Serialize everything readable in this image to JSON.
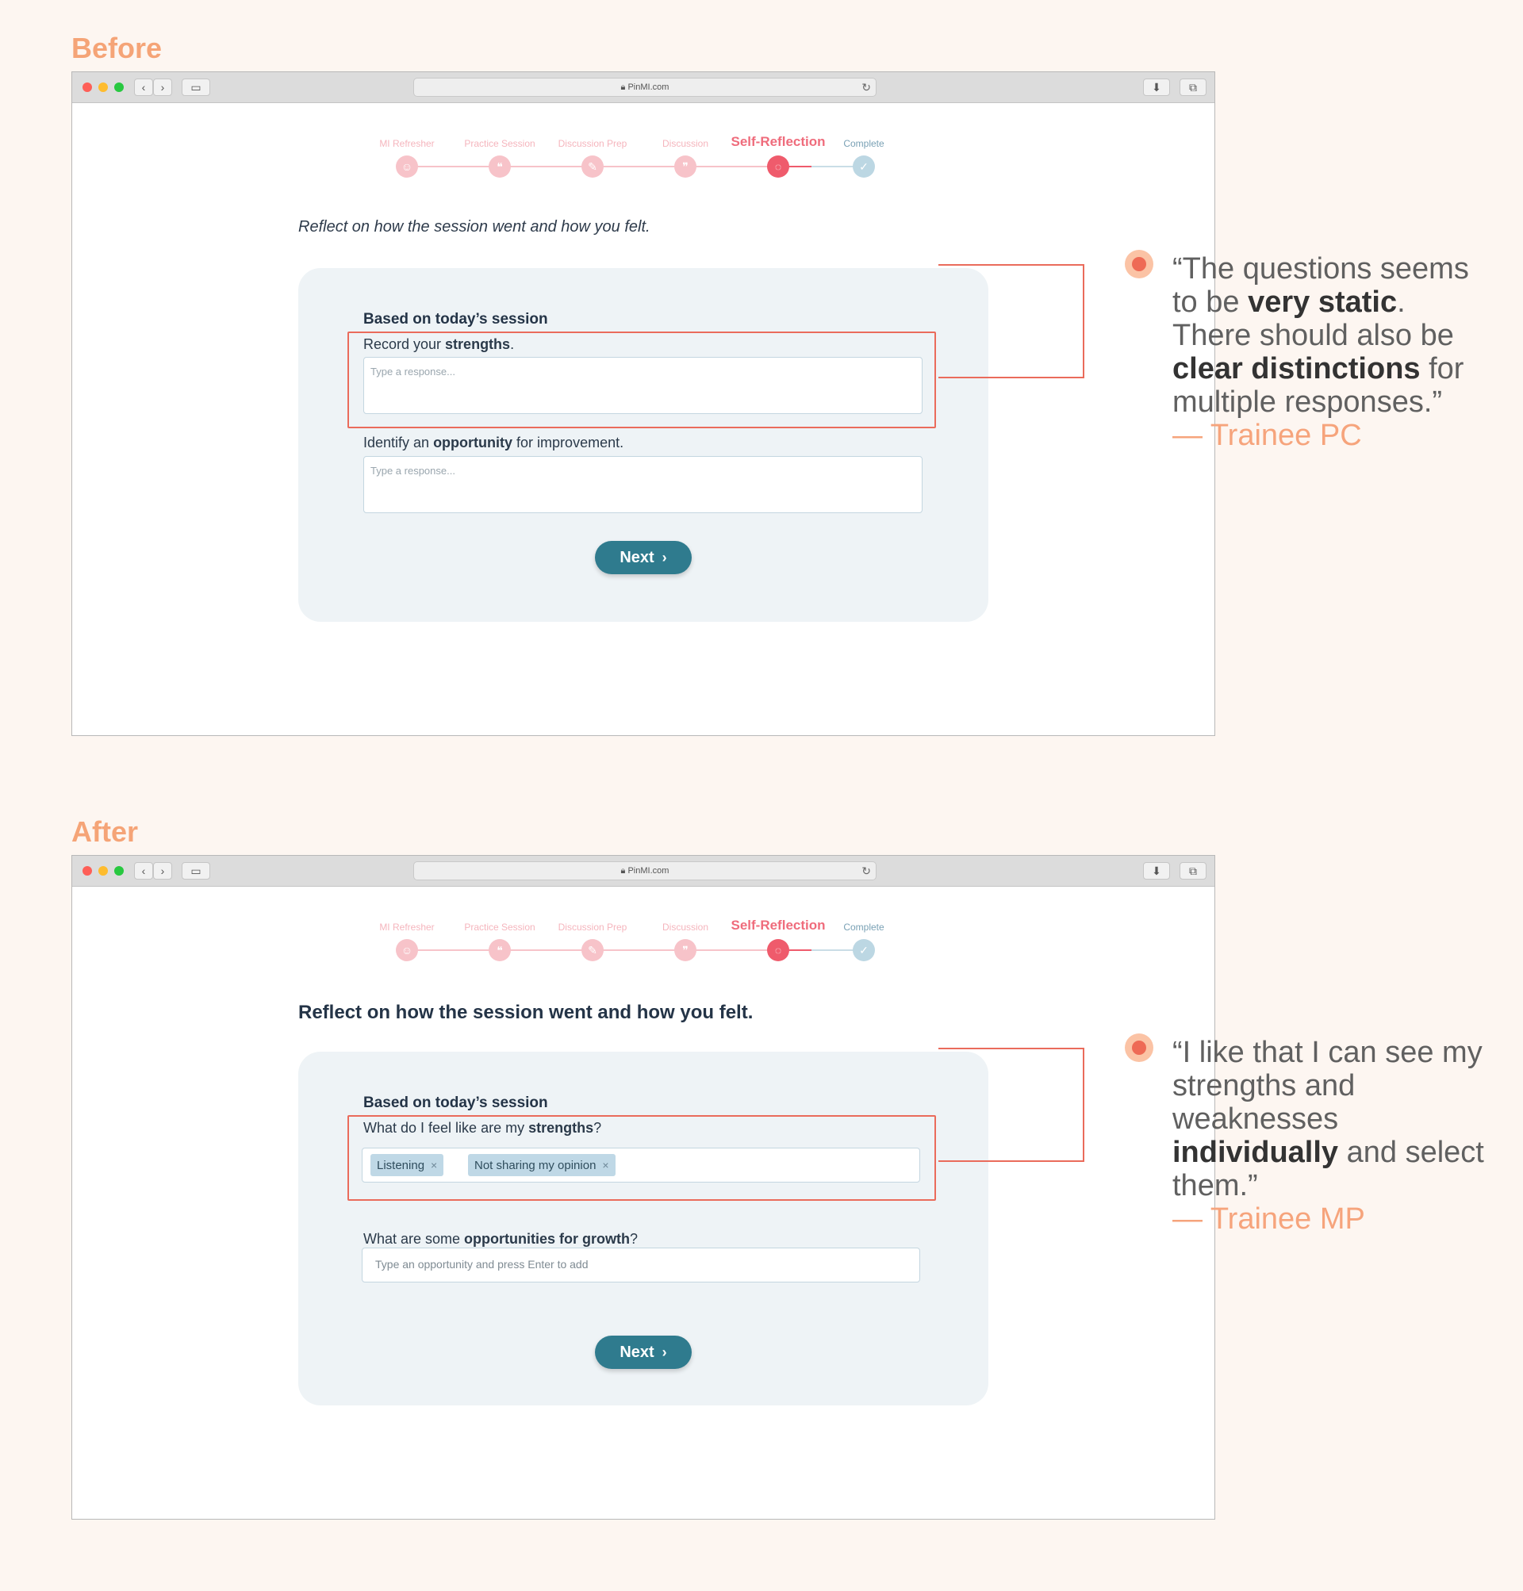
{
  "before": {
    "section_label": "Before",
    "url": "PinMI.com",
    "steps": [
      {
        "label": "MI Refresher"
      },
      {
        "label": "Practice Session"
      },
      {
        "label": "Discussion Prep"
      },
      {
        "label": "Discussion"
      },
      {
        "label": "Self-Reflection"
      },
      {
        "label": "Complete"
      }
    ],
    "prompt": "Reflect on how the session went and how you felt.",
    "card_title": "Based on today’s session",
    "q1_prefix": "Record your ",
    "q1_bold": "strengths",
    "q1_suffix": ".",
    "q1_placeholder": "Type a response...",
    "q2_prefix": "Identify an ",
    "q2_bold": "opportunity",
    "q2_suffix": " for improvement.",
    "q2_placeholder": "Type a response...",
    "next_label": "Next",
    "quote": {
      "p1": "“The questions seems to be ",
      "b1": "very static",
      "p2": ". There should also be ",
      "b2": "clear distinctions",
      "p3": " for multiple responses.”",
      "author": "— Trainee PC"
    }
  },
  "after": {
    "section_label": "After",
    "url": "PinMI.com",
    "steps": [
      {
        "label": "MI Refresher"
      },
      {
        "label": "Practice Session"
      },
      {
        "label": "Discussion Prep"
      },
      {
        "label": "Discussion"
      },
      {
        "label": "Self-Reflection"
      },
      {
        "label": "Complete"
      }
    ],
    "prompt": "Reflect on how the session went and how you felt.",
    "card_title": "Based on today’s session",
    "q1_prefix": "What do I feel like are my ",
    "q1_bold": "strengths",
    "q1_suffix": "?",
    "chips": [
      "Listening",
      "Not sharing my opinion"
    ],
    "q2_prefix": "What are some ",
    "q2_bold": "opportunities for growth",
    "q2_suffix": "?",
    "q2_placeholder": "Type an opportunity and press Enter to add",
    "next_label": "Next",
    "quote": {
      "p1": "“I like that I can see my strengths and weaknesses ",
      "b1": "individually",
      "p2": " and select them.”",
      "author": "— Trainee MP"
    }
  },
  "colors": {
    "accent": "#f5a477",
    "highlight": "#ea6b5b",
    "button": "#2f7b8e",
    "active_step": "#ef5b6c"
  },
  "icons": {
    "close": "close-icon",
    "chevron": "chevron-right-icon",
    "check": "check-icon",
    "lock": "lock-icon",
    "reload": "reload-icon"
  }
}
